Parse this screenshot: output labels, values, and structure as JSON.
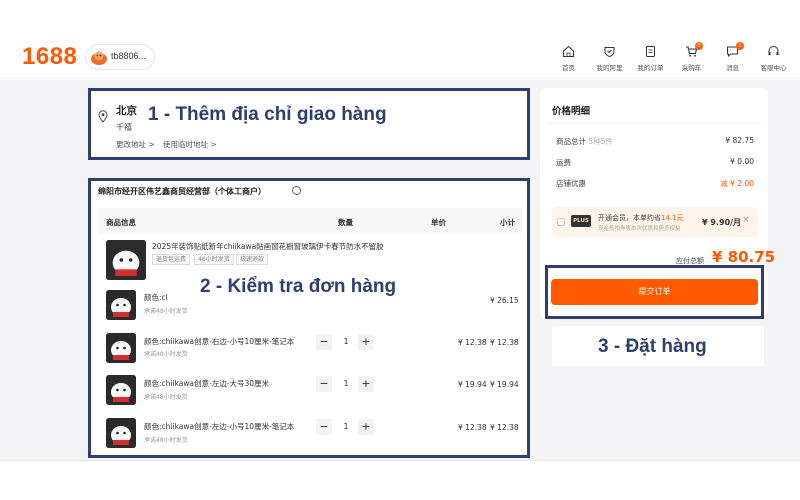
{
  "header": {
    "logo": "1688",
    "username": "tb8806...",
    "nav": [
      {
        "label": "首页",
        "icon": "home-icon",
        "badge": ""
      },
      {
        "label": "我的阿里",
        "icon": "profile-icon",
        "badge": ""
      },
      {
        "label": "我的订单",
        "icon": "order-icon",
        "badge": ""
      },
      {
        "label": "采购车",
        "icon": "cart-icon",
        "badge": "0"
      },
      {
        "label": "消息",
        "icon": "message-icon",
        "badge": "1"
      },
      {
        "label": "客服中心",
        "icon": "support-icon",
        "badge": ""
      }
    ]
  },
  "address": {
    "city": "北京",
    "district": "千禧",
    "change_label": "更改地址 >",
    "temp_label": "使用临时地址 >"
  },
  "annotations": {
    "step1": "1 - Thêm địa chỉ giao hàng",
    "step2": "2 - Kiểm tra đơn hàng",
    "step3": "3 - Đặt hàng"
  },
  "order": {
    "shop_name": "绵阳市经开区伟艺鑫商贸经营部（个体工商户）",
    "columns": {
      "product": "商品信息",
      "quantity": "数量",
      "unit_price": "单价",
      "subtotal": "小计"
    },
    "product_title": "2025年装饰贴纸新年chiikawa贴画窗花橱窗玻璃伊卡春节防水不留胶",
    "tags": [
      "退货包运费",
      "48小时发货",
      "极速退款"
    ],
    "items": [
      {
        "name": "颜色:cl",
        "sub": "承诺48小时发货",
        "qty": "",
        "price": "",
        "subtotal": "¥ 26.15"
      },
      {
        "name": "颜色:chiikawa创意-右边-小号10厘米-笔记本",
        "sub": "承诺48小时发货",
        "qty": "1",
        "price": "¥ 12.38",
        "subtotal": "¥ 12.38"
      },
      {
        "name": "颜色:chiikawa创意-左边-大号30厘米",
        "sub": "承诺48小时发货",
        "qty": "1",
        "price": "¥ 19.94",
        "subtotal": "¥ 19.94"
      },
      {
        "name": "颜色:chiikawa创意-左边-小号10厘米-笔记本",
        "sub": "承诺48小时发货",
        "qty": "1",
        "price": "¥ 12.38",
        "subtotal": "¥ 12.38"
      }
    ],
    "step_minus": "−",
    "step_plus": "+"
  },
  "summary": {
    "title": "价格明细",
    "goods_label": "商品总计",
    "goods_count": "5种5件",
    "goods_value": "¥ 82.75",
    "shipping_label": "运费",
    "shipping_value": "¥ 0.00",
    "discount_label": "店铺优惠",
    "discount_value": "减 ¥ 2.00",
    "member_badge": "PLUS",
    "member_text": "开通会员，本单约省",
    "member_saving": "14.1元",
    "member_sub": "现金抵扣券等本次优惠和更多权益",
    "member_price": "¥ 9.90/月",
    "member_close": "×",
    "total_label": "应付总额",
    "total_value": "¥ 80.75",
    "submit_label": "提交订单"
  },
  "colors": {
    "accent": "#ff5a00",
    "annotation": "#2e3f6e"
  }
}
